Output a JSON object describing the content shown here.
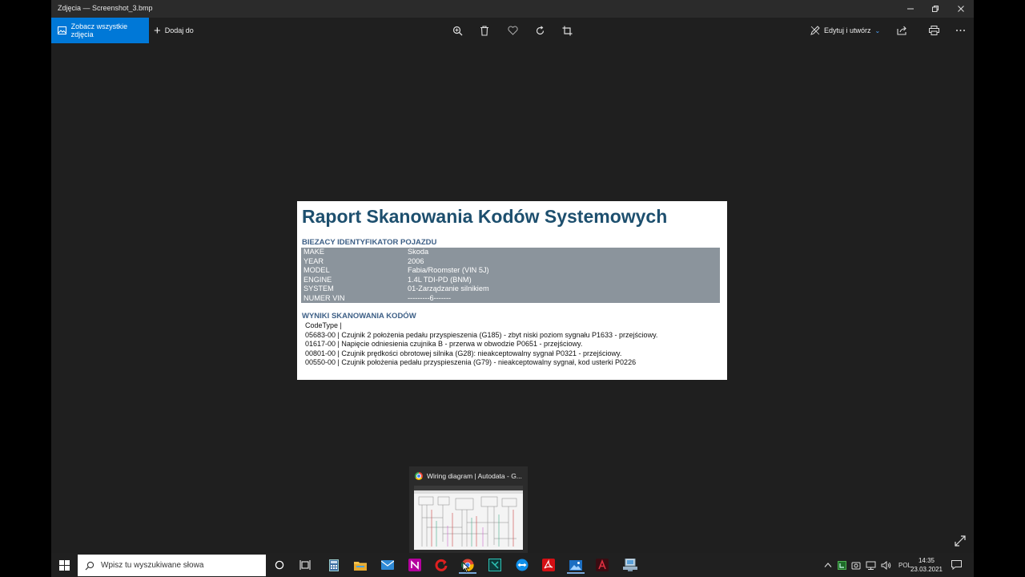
{
  "window": {
    "title": "Zdjęcia — Screenshot_3.bmp"
  },
  "toolbar": {
    "see_all_label": "Zobacz wszystkie zdjęcia",
    "add_label": "Dodaj do",
    "edit_label": "Edytuj i utwórz"
  },
  "report": {
    "title": "Raport Skanowania Kodów Systemowych",
    "vehicle_section": "BIEZACY IDENTYFIKATOR POJAZDU",
    "vehicle": [
      {
        "key": "MAKE",
        "value": "Skoda"
      },
      {
        "key": "YEAR",
        "value": "2006"
      },
      {
        "key": "MODEL",
        "value": "Fabia/Roomster (VIN 5J)"
      },
      {
        "key": "ENGINE",
        "value": "1.4L TDI-PD (BNM)"
      },
      {
        "key": "SYSTEM",
        "value": "01-Zarządzanie silnikiem"
      },
      {
        "key": "NUMER VIN",
        "value": "---------6-------"
      }
    ],
    "results_section": "WYNIKI SKANOWANIA KODÓW",
    "code_header": "CodeType |",
    "codes": [
      "05683-00 | Czujnik 2 położenia pedału przyspieszenia (G185) - zbyt niski poziom sygnału P1633 - przejściowy.",
      "01617-00 | Napięcie odniesienia czujnika B - przerwa w obwodzie P0651 - przejściowy.",
      "00801-00 | Czujnik prędkości obrotowej silnika (G28): nieakceptowalny sygnał P0321 - przejściowy.",
      "00550-00 | Czujnik położenia pedału przyspieszenia (G79) - nieakceptowalny sygnał, kod usterki P0226"
    ]
  },
  "thumbnail": {
    "title": "Wiring diagram | Autodata - G..."
  },
  "taskbar": {
    "search_placeholder": "Wpisz tu wyszukiwane słowa",
    "language": "POL",
    "time": "14:35",
    "date": "23.03.2021"
  },
  "colors": {
    "accent": "#0078d7",
    "report_title": "#1d4f6e",
    "section_heading": "#3d5f86",
    "table_bg": "#8b949c"
  }
}
